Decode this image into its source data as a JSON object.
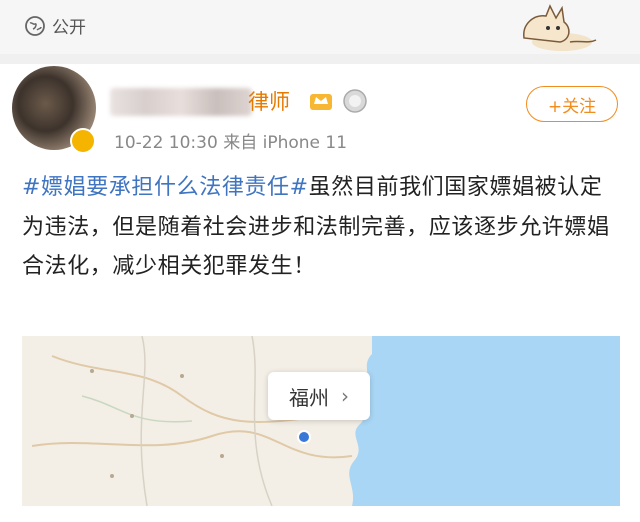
{
  "visibility": {
    "label": "公开",
    "icon": "globe-icon"
  },
  "author": {
    "name_visible_suffix": "律师",
    "meta_date": "10-22 10:30",
    "meta_source": "来自 iPhone 11"
  },
  "follow_button": {
    "label": "+关注"
  },
  "post": {
    "hashtag": "#嫖娼要承担什么法律责任#",
    "body": "虽然目前我们国家嫖娼被认定为违法，但是随着社会进步和法制完善，应该逐步允许嫖娼合法化，减少相关犯罪发生！"
  },
  "map": {
    "city": "福州",
    "chevron": "›",
    "sea_color": "#a9d6f5",
    "land_color": "#f3efe6"
  },
  "colors": {
    "accent": "#f28c1e",
    "link": "#3f74c1",
    "name": "#e57a00"
  }
}
